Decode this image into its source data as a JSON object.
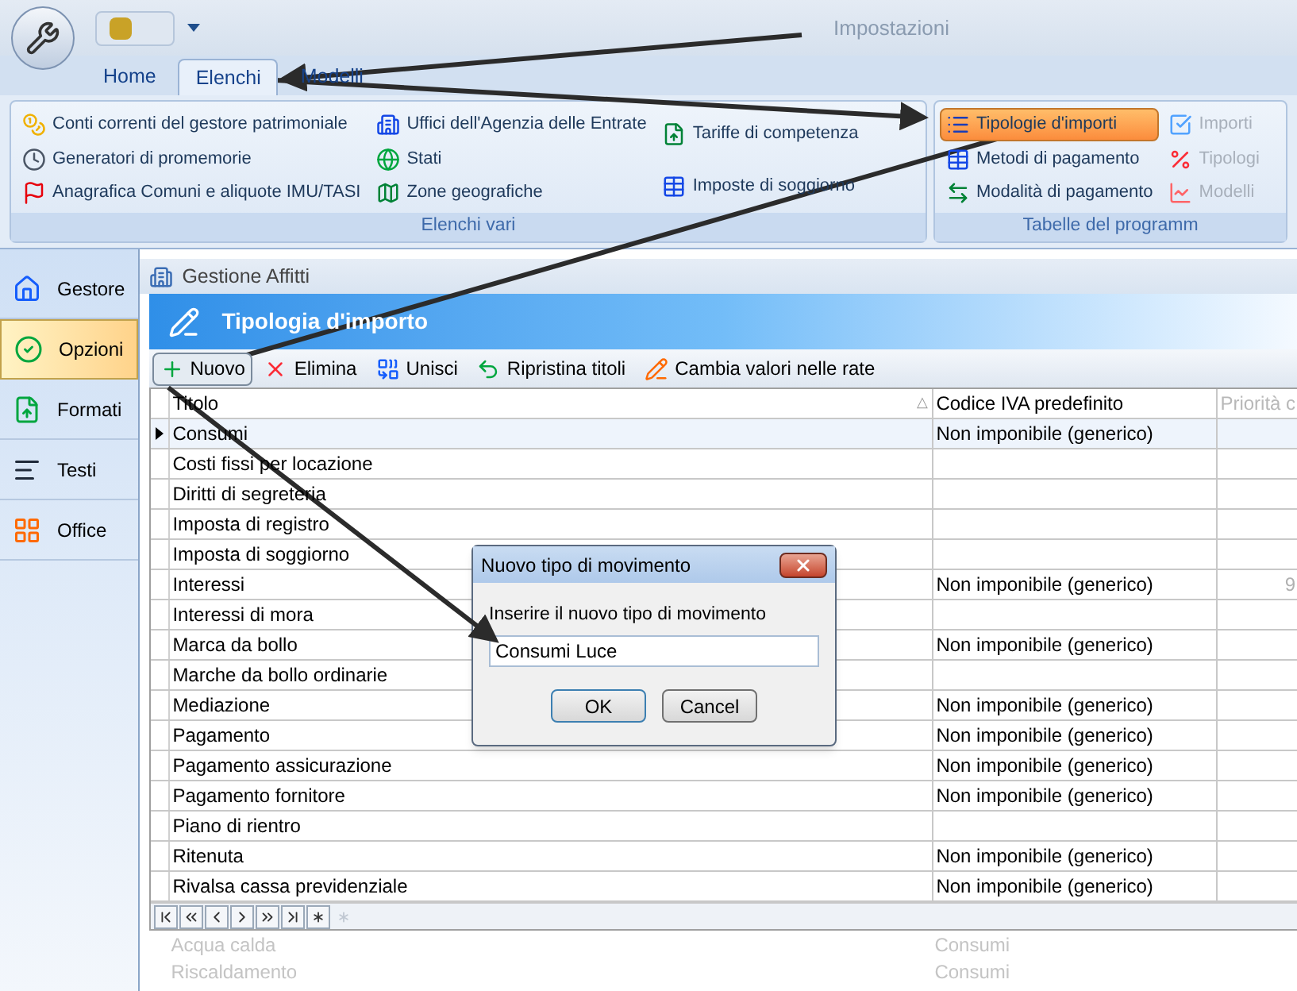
{
  "window": {
    "title": "Impostazioni"
  },
  "tabs": [
    {
      "label": "Home",
      "selected": false
    },
    {
      "label": "Elenchi",
      "selected": true
    },
    {
      "label": "Modelli",
      "selected": false
    }
  ],
  "ribbon": {
    "groups": [
      {
        "label": "Elenchi vari",
        "columns": [
          [
            {
              "label": "Conti correnti del gestore patrimoniale",
              "selected": false,
              "disabled": false
            },
            {
              "label": "Generatori di promemorie",
              "selected": false,
              "disabled": false
            },
            {
              "label": "Anagrafica Comuni e aliquote IMU/TASI",
              "selected": false,
              "disabled": false
            }
          ],
          [
            {
              "label": "Uffici dell'Agenzia delle Entrate",
              "selected": false,
              "disabled": false
            },
            {
              "label": "Stati",
              "selected": false,
              "disabled": false
            },
            {
              "label": "Zone geografiche",
              "selected": false,
              "disabled": false
            }
          ],
          [
            {
              "label": "Tariffe di competenza",
              "selected": false,
              "disabled": false
            },
            {
              "label": "Imposte di soggiorno",
              "selected": false,
              "disabled": false
            }
          ]
        ]
      },
      {
        "label": "Tabelle del programm",
        "columns": [
          [
            {
              "label": "Tipologie d'importi",
              "selected": true,
              "disabled": false
            },
            {
              "label": "Metodi di pagamento",
              "selected": false,
              "disabled": false
            },
            {
              "label": "Modalità di pagamento",
              "selected": false,
              "disabled": false
            }
          ],
          [
            {
              "label": "Importi",
              "selected": false,
              "disabled": true
            },
            {
              "label": "Tipologi",
              "selected": false,
              "disabled": true
            },
            {
              "label": "Modelli",
              "selected": false,
              "disabled": true
            }
          ]
        ]
      }
    ]
  },
  "sidebar": {
    "items": [
      {
        "label": "Gestore",
        "selected": false
      },
      {
        "label": "Opzioni",
        "selected": true
      },
      {
        "label": "Formati",
        "selected": false
      },
      {
        "label": "Testi",
        "selected": false
      },
      {
        "label": "Office",
        "selected": false
      }
    ]
  },
  "document": {
    "app_title": "Gestione Affitti",
    "header": "Tipologia d'importo",
    "toolbar": [
      {
        "label": "Nuovo",
        "pressed": true
      },
      {
        "label": "Elimina",
        "pressed": false
      },
      {
        "label": "Unisci",
        "pressed": false
      },
      {
        "label": "Ripristina titoli",
        "pressed": false
      },
      {
        "label": "Cambia valori nelle rate",
        "pressed": false
      }
    ],
    "table": {
      "columns": [
        "Titolo",
        "Codice IVA predefinito",
        "Priorità c"
      ],
      "sort_indicator": "△",
      "rows": [
        {
          "cells": [
            "Consumi",
            "Non imponibile (generico)",
            ""
          ],
          "selected": true
        },
        {
          "cells": [
            "Costi fissi per locazione",
            "",
            ""
          ],
          "selected": false
        },
        {
          "cells": [
            "Diritti di segreteria",
            "",
            ""
          ],
          "selected": false
        },
        {
          "cells": [
            "Imposta di registro",
            "",
            ""
          ],
          "selected": false
        },
        {
          "cells": [
            "Imposta di soggiorno",
            "",
            ""
          ],
          "selected": false
        },
        {
          "cells": [
            "Interessi",
            "Non imponibile (generico)",
            "9"
          ],
          "selected": false
        },
        {
          "cells": [
            "Interessi di mora",
            "",
            ""
          ],
          "selected": false
        },
        {
          "cells": [
            "Marca da bollo",
            "Non imponibile (generico)",
            ""
          ],
          "selected": false
        },
        {
          "cells": [
            "Marche da bollo ordinarie",
            "",
            ""
          ],
          "selected": false
        },
        {
          "cells": [
            "Mediazione",
            "Non imponibile (generico)",
            ""
          ],
          "selected": false
        },
        {
          "cells": [
            "Pagamento",
            "Non imponibile (generico)",
            ""
          ],
          "selected": false
        },
        {
          "cells": [
            "Pagamento assicurazione",
            "Non imponibile (generico)",
            ""
          ],
          "selected": false
        },
        {
          "cells": [
            "Pagamento fornitore",
            "Non imponibile (generico)",
            ""
          ],
          "selected": false
        },
        {
          "cells": [
            "Piano di rientro",
            "",
            ""
          ],
          "selected": false
        },
        {
          "cells": [
            "Ritenuta",
            "Non imponibile (generico)",
            ""
          ],
          "selected": false
        },
        {
          "cells": [
            "Rivalsa cassa previdenziale",
            "Non imponibile (generico)",
            ""
          ],
          "selected": false
        }
      ],
      "faded_rows": [
        {
          "cells": [
            "Acqua calda",
            "Consumi"
          ]
        },
        {
          "cells": [
            "Riscaldamento",
            "Consumi"
          ]
        }
      ]
    }
  },
  "dialog": {
    "title": "Nuovo tipo di movimento",
    "prompt": "Inserire il nuovo tipo di movimento",
    "value": "Consumi Luce",
    "buttons": [
      "OK",
      "Cancel"
    ]
  }
}
